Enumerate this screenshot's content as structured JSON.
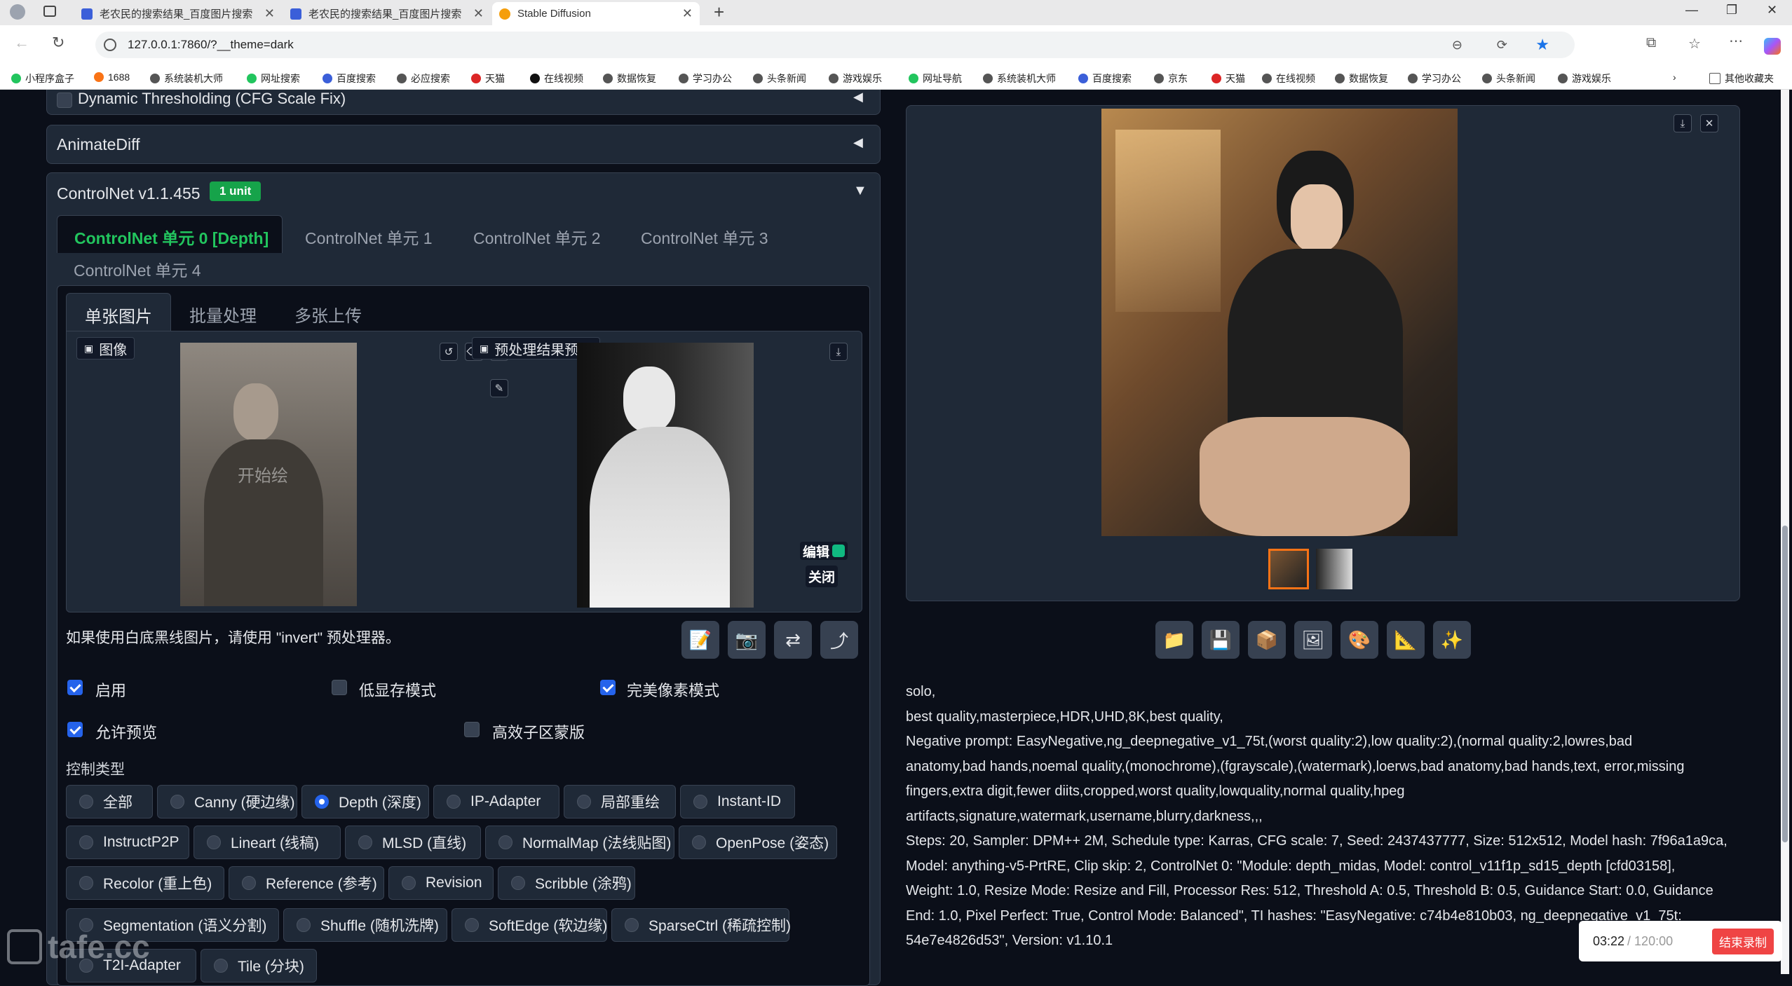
{
  "browser": {
    "tabs": [
      {
        "title": "老农民的搜索结果_百度图片搜索",
        "close": "✕"
      },
      {
        "title": "老农民的搜索结果_百度图片搜索",
        "close": "✕"
      },
      {
        "title": "Stable Diffusion",
        "close": "✕"
      }
    ],
    "url": "127.0.0.1:7860/?__theme=dark",
    "bookmarks": [
      "小程序盒子",
      "1688",
      "系统装机大师",
      "网址搜索",
      "百度搜索",
      "必应搜索",
      "天猫",
      "在线视频",
      "数据恢复",
      "学习办公",
      "头条新闻",
      "游戏娱乐",
      "网址导航",
      "系统装机大师",
      "百度搜索",
      "京东",
      "天猫",
      "在线视频",
      "数据恢复",
      "学习办公",
      "头条新闻",
      "游戏娱乐"
    ],
    "other_bookmarks": "其他收藏夹"
  },
  "left": {
    "dynamic_thresholding": "Dynamic Thresholding (CFG Scale Fix)",
    "animatediff": "AnimateDiff",
    "controlnet_title": "ControlNet v1.1.455",
    "controlnet_badge": "1 unit",
    "unit_tabs": [
      "ControlNet 单元 0 [Depth]",
      "ControlNet 单元 1",
      "ControlNet 单元 2",
      "ControlNet 单元 3",
      "ControlNet 单元 4"
    ],
    "input_tabs": [
      "单张图片",
      "批量处理",
      "多张上传"
    ],
    "image_label": "图像",
    "image_overlay": "开始绘",
    "preview_label": "预处理结果预览",
    "edit_label": "编辑",
    "close_label": "关闭",
    "hint": "如果使用白底黑线图片，请使用 \"invert\" 预处理器。",
    "options": {
      "enable": "启用",
      "low_vram": "低显存模式",
      "pixel_perfect": "完美像素模式",
      "allow_preview": "允许预览",
      "efficient": "高效子区蒙版"
    },
    "control_type_label": "控制类型",
    "control_types": [
      [
        "全部",
        "Canny (硬边缘)",
        "Depth (深度)",
        "IP-Adapter",
        "局部重绘",
        "Instant-ID"
      ],
      [
        "InstructP2P",
        "Lineart (线稿)",
        "MLSD (直线)",
        "NormalMap (法线贴图)",
        "OpenPose (姿态)"
      ],
      [
        "Recolor (重上色)",
        "Reference (参考)",
        "Revision",
        "Scribble (涂鸦)"
      ],
      [
        "Segmentation (语义分割)",
        "Shuffle (随机洗牌)",
        "SoftEdge (软边缘)",
        "SparseCtrl (稀疏控制)"
      ],
      [
        "T2I-Adapter",
        "Tile (分块)"
      ]
    ],
    "selected_control_type": "Depth (深度)"
  },
  "right": {
    "gen_info": [
      "solo,",
      "best quality,masterpiece,HDR,UHD,8K,best quality,",
      "Negative prompt: EasyNegative,ng_deepnegative_v1_75t,(worst quality:2),low quality:2),(normal quality:2,lowres,bad",
      "anatomy,bad hands,noemal quality,(monochrome),(fgrayscale),(watermark),loerws,bad anatomy,bad hands,text, error,missing",
      "fingers,extra digit,fewer diits,cropped,worst quality,lowquality,normal quality,hpeg",
      "artifacts,signature,watermark,username,blurry,darkness,,,",
      "Steps: 20, Sampler: DPM++ 2M, Schedule type: Karras, CFG scale: 7, Seed: 2437437777, Size: 512x512, Model hash: 7f96a1a9ca,",
      "Model: anything-v5-PrtRE, Clip skip: 2, ControlNet 0: \"Module: depth_midas, Model: control_v11f1p_sd15_depth [cfd03158],",
      "Weight: 1.0, Resize Mode: Resize and Fill, Processor Res: 512, Threshold A: 0.5, Threshold B: 0.5, Guidance Start: 0.0, Guidance",
      "End: 1.0, Pixel Perfect: True, Control Mode: Balanced\", TI hashes: \"EasyNegative: c74b4e810b03, ng_deepnegative_v1_75t:",
      "54e7e4826d53\", Version: v1.10.1"
    ]
  },
  "recording": {
    "elapsed": "03:22",
    "total": "/ 120:00",
    "stop": "结束录制"
  },
  "watermark": "tafe.cc",
  "colors": {
    "accent": "#2563eb",
    "badge": "#16a34a",
    "active_tab_text": "#22c55e"
  }
}
